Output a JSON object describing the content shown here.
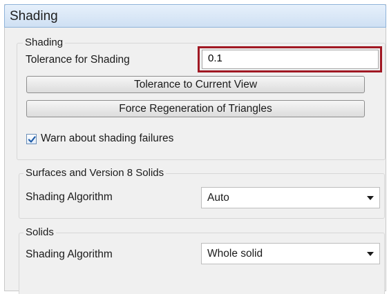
{
  "panel": {
    "title": "Shading"
  },
  "shading_group": {
    "title": "Shading",
    "tolerance_label": "Tolerance for Shading",
    "tolerance_value": "0.1",
    "tolerance_to_view_button": "Tolerance to Current View",
    "force_regeneration_button": "Force Regeneration of Triangles",
    "warn_checkbox": {
      "label": "Warn about shading failures",
      "checked": true
    }
  },
  "surfaces_group": {
    "title": "Surfaces and Version 8 Solids",
    "algorithm_label": "Shading Algorithm",
    "algorithm_value": "Auto"
  },
  "solids_group": {
    "title": "Solids",
    "algorithm_label": "Shading Algorithm",
    "algorithm_value": "Whole solid"
  },
  "colors": {
    "highlight_border": "#a01823",
    "checkbox_check": "#1f5ca8"
  },
  "icons": {
    "checkmark": "check-icon",
    "dropdown": "chevron-down-icon"
  }
}
